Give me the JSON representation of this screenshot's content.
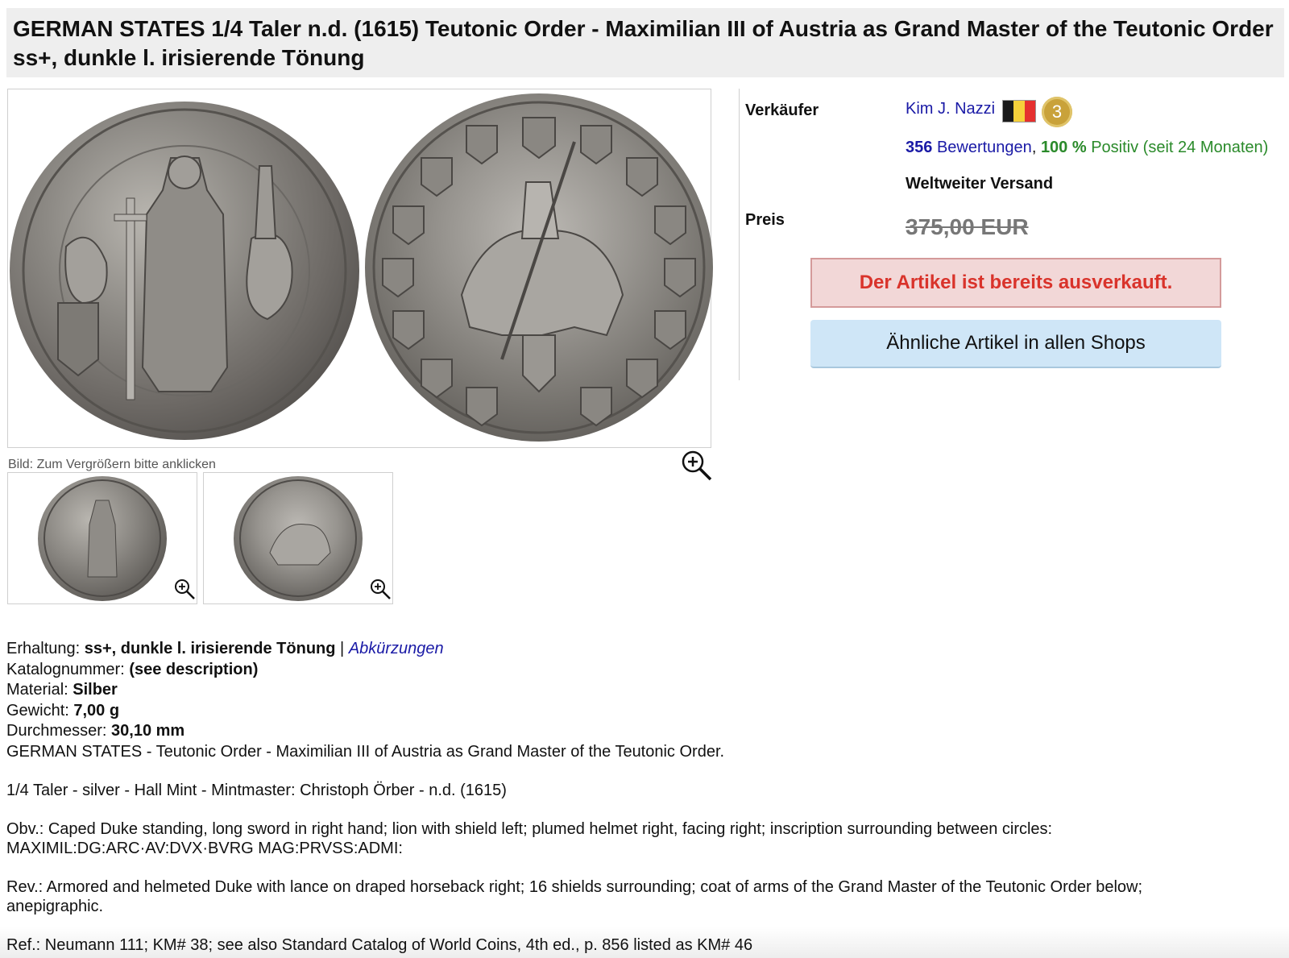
{
  "title": "GERMAN STATES 1/4 Taler n.d. (1615) Teutonic Order - Maximilian III of Austria as Grand Master of the Teutonic Order ss+, dunkle l. irisierende Tönung",
  "image": {
    "caption": "Bild: Zum Vergrößern bitte anklicken",
    "zoom_icon": "magnifier-zoom-icon"
  },
  "seller": {
    "label": "Verkäufer",
    "name": "Kim J. Nazzi",
    "flag_colors": [
      "#1a1a1a",
      "#f6d13b",
      "#e5302f"
    ],
    "badge": "3",
    "ratings_count": "356",
    "ratings_label": "Bewertungen",
    "comma": ",",
    "positive_pct": "100 %",
    "positive_label": "Positiv (seit 24 Monaten)",
    "shipping": "Weltweiter Versand"
  },
  "price": {
    "label": "Preis",
    "value": "375,00 EUR"
  },
  "status": {
    "sold_out": "Der Artikel ist bereits ausverkauft.",
    "similar_button": "Ähnliche Artikel in allen Shops"
  },
  "details": {
    "condition_label": "Erhaltung:",
    "condition_value": "ss+, dunkle l. irisierende Tönung",
    "separator": "|",
    "abbreviations_link": "Abkürzungen",
    "catalog_label": "Katalognummer:",
    "catalog_value": "(see description)",
    "material_label": "Material:",
    "material_value": "Silber",
    "weight_label": "Gewicht:",
    "weight_value": "7,00 g",
    "diameter_label": "Durchmesser:",
    "diameter_value": "30,10 mm"
  },
  "description": {
    "line1": "GERMAN STATES - Teutonic Order - Maximilian III of Austria as Grand Master of the Teutonic Order.",
    "line2": "1/4 Taler - silver - Hall Mint - Mintmaster: Christoph Örber - n.d. (1615)",
    "obv_a": "Obv.: Caped Duke standing, long sword in right hand; lion with shield left; plumed helmet right, facing right; inscription surrounding between circles:",
    "obv_b": "MAXIMIL:DG:ARC·AV:DVX·BVRG MAG:PRVSS:ADMI:",
    "rev_a": "Rev.: Armored and helmeted Duke with lance on draped horseback right; 16 shields surrounding; coat of arms of the Grand Master of the Teutonic Order below;",
    "rev_b": "anepigraphic.",
    "ref": "Ref.: Neumann 111; KM# 38; see also Standard Catalog of World Coins, 4th ed., p. 856 listed as KM# 46"
  }
}
